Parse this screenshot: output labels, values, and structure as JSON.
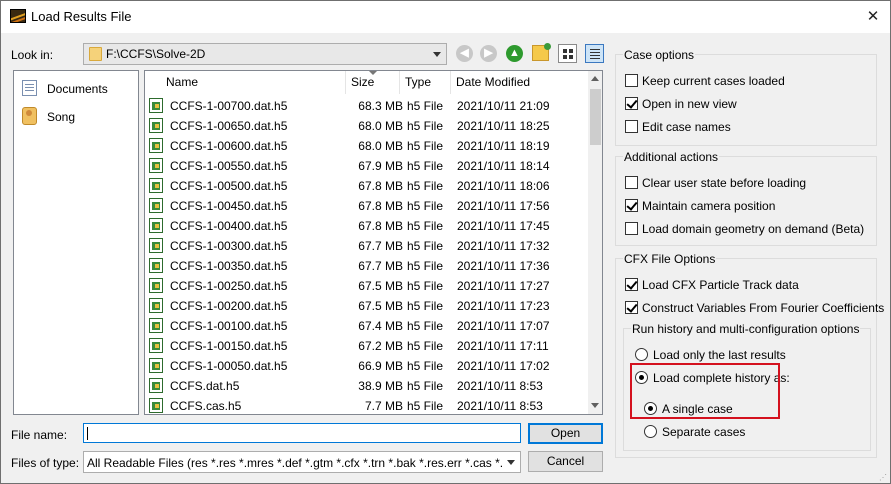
{
  "window": {
    "title": "Load Results File",
    "close_glyph": "✕"
  },
  "lookin": {
    "label": "Look in:",
    "path": "F:\\CCFS\\Solve-2D"
  },
  "places": [
    {
      "label": "Documents",
      "icon": "documents-icon"
    },
    {
      "label": "Song",
      "icon": "user-folder-icon"
    }
  ],
  "filelist": {
    "columns": [
      "Name",
      "Size",
      "Type",
      "Date Modified"
    ],
    "rows": [
      {
        "name": "CCFS-1-00700.dat.h5",
        "size": "68.3 MB",
        "type": "h5 File",
        "date": "2021/10/11 21:09"
      },
      {
        "name": "CCFS-1-00650.dat.h5",
        "size": "68.0 MB",
        "type": "h5 File",
        "date": "2021/10/11 18:25"
      },
      {
        "name": "CCFS-1-00600.dat.h5",
        "size": "68.0 MB",
        "type": "h5 File",
        "date": "2021/10/11 18:19"
      },
      {
        "name": "CCFS-1-00550.dat.h5",
        "size": "67.9 MB",
        "type": "h5 File",
        "date": "2021/10/11 18:14"
      },
      {
        "name": "CCFS-1-00500.dat.h5",
        "size": "67.8 MB",
        "type": "h5 File",
        "date": "2021/10/11 18:06"
      },
      {
        "name": "CCFS-1-00450.dat.h5",
        "size": "67.8 MB",
        "type": "h5 File",
        "date": "2021/10/11 17:56"
      },
      {
        "name": "CCFS-1-00400.dat.h5",
        "size": "67.8 MB",
        "type": "h5 File",
        "date": "2021/10/11 17:45"
      },
      {
        "name": "CCFS-1-00300.dat.h5",
        "size": "67.7 MB",
        "type": "h5 File",
        "date": "2021/10/11 17:32"
      },
      {
        "name": "CCFS-1-00350.dat.h5",
        "size": "67.7 MB",
        "type": "h5 File",
        "date": "2021/10/11 17:36"
      },
      {
        "name": "CCFS-1-00250.dat.h5",
        "size": "67.5 MB",
        "type": "h5 File",
        "date": "2021/10/11 17:27"
      },
      {
        "name": "CCFS-1-00200.dat.h5",
        "size": "67.5 MB",
        "type": "h5 File",
        "date": "2021/10/11 17:23"
      },
      {
        "name": "CCFS-1-00100.dat.h5",
        "size": "67.4 MB",
        "type": "h5 File",
        "date": "2021/10/11 17:07"
      },
      {
        "name": "CCFS-1-00150.dat.h5",
        "size": "67.2 MB",
        "type": "h5 File",
        "date": "2021/10/11 17:11"
      },
      {
        "name": "CCFS-1-00050.dat.h5",
        "size": "66.9 MB",
        "type": "h5 File",
        "date": "2021/10/11 17:02"
      },
      {
        "name": "CCFS.dat.h5",
        "size": "38.9 MB",
        "type": "h5 File",
        "date": "2021/10/11 8:53"
      },
      {
        "name": "CCFS.cas.h5",
        "size": "7.7 MB",
        "type": "h5 File",
        "date": "2021/10/11 8:53"
      }
    ]
  },
  "bottom": {
    "filename_label": "File name:",
    "filename_value": "",
    "filetype_label": "Files of type:",
    "filetype_value": "All Readable Files (res *.res *.mres *.def *.gtm *.cfx *.trn *.bak *.res.err *.cas *.cas",
    "open_label": "Open",
    "cancel_label": "Cancel"
  },
  "case_options": {
    "title": "Case options",
    "items": [
      {
        "label": "Keep current cases loaded",
        "checked": false
      },
      {
        "label": "Open in new view",
        "checked": true
      },
      {
        "label": "Edit case names",
        "checked": false
      }
    ]
  },
  "additional_actions": {
    "title": "Additional actions",
    "items": [
      {
        "label": "Clear user state before loading",
        "checked": false
      },
      {
        "label": "Maintain camera position",
        "checked": true
      },
      {
        "label": "Load domain geometry on demand (Beta)",
        "checked": false
      }
    ]
  },
  "cfx_options": {
    "title": "CFX File Options",
    "items": [
      {
        "label": "Load CFX Particle Track data",
        "checked": true
      },
      {
        "label": "Construct Variables From Fourier Coefficients",
        "checked": true
      }
    ],
    "run_history": {
      "title": "Run history and multi-configuration options",
      "radios": [
        {
          "label": "Load only the last results",
          "selected": false
        },
        {
          "label": "Load complete history as:",
          "selected": true
        }
      ],
      "sub_radios": [
        {
          "label": "A single case",
          "selected": true
        },
        {
          "label": "Separate cases",
          "selected": false
        }
      ]
    }
  },
  "colors": {
    "highlight_box": "#d4111e",
    "focus_border": "#0078d7"
  }
}
